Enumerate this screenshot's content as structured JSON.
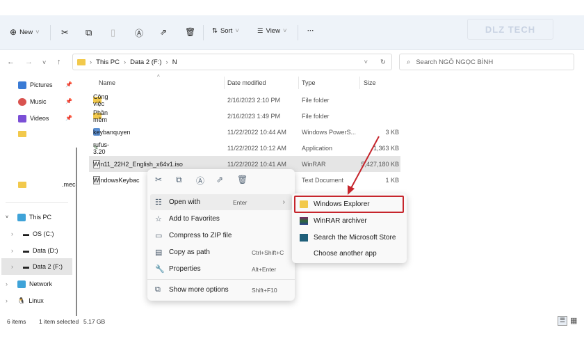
{
  "toolbar": {
    "new": "New",
    "sort": "Sort",
    "view": "View",
    "more": "···",
    "logo": "DLZ TECH"
  },
  "address": {
    "parts": [
      "This PC",
      "Data 2 (F:)",
      "N"
    ],
    "search_placeholder": "Search NGÔ NGỌC BÌNH"
  },
  "sidebar": {
    "quick": [
      {
        "label": "Pictures",
        "color": "#3a7bd5"
      },
      {
        "label": "Music",
        "color": "#d9534f"
      },
      {
        "label": "Videos",
        "color": "#7b4fd6"
      }
    ],
    "hidden_item": ".mec",
    "this_pc": "This PC",
    "drives": [
      "OS (C:)",
      "Data (D:)",
      "Data 2 (F:)"
    ],
    "network": "Network",
    "linux": "Linux"
  },
  "columns": [
    "Name",
    "Date modified",
    "Type",
    "Size"
  ],
  "files": [
    {
      "name": "Công việc",
      "date": "2/16/2023 2:10 PM",
      "type": "File folder",
      "size": "",
      "icon": "folder"
    },
    {
      "name": "Phần mềm",
      "date": "2/16/2023 1:49 PM",
      "type": "File folder",
      "size": "",
      "icon": "folder"
    },
    {
      "name": "keybanquyen",
      "date": "11/22/2022 10:44 AM",
      "type": "Windows PowerS...",
      "size": "3 KB",
      "icon": "powershell"
    },
    {
      "name": "rufus-3.20",
      "date": "11/22/2022 10:12 AM",
      "type": "Application",
      "size": "1,363 KB",
      "icon": "app"
    },
    {
      "name": "Win11_22H2_English_x64v1.iso",
      "date": "11/22/2022 10:41 AM",
      "type": "WinRAR",
      "size": "5,427,180 KB",
      "icon": "file"
    },
    {
      "name": "WindowsKeybac",
      "date": "",
      "type": "Text Document",
      "size": "1 KB",
      "icon": "text"
    }
  ],
  "context_menu": {
    "items": [
      {
        "label": "Open with",
        "shortcut": "Enter"
      },
      {
        "label": "Add to Favorites",
        "shortcut": ""
      },
      {
        "label": "Compress to ZIP file",
        "shortcut": ""
      },
      {
        "label": "Copy as path",
        "shortcut": "Ctrl+Shift+C"
      },
      {
        "label": "Properties",
        "shortcut": "Alt+Enter"
      },
      {
        "label": "Show more options",
        "shortcut": "Shift+F10"
      }
    ]
  },
  "submenu": {
    "items": [
      "Windows Explorer",
      "WinRAR archiver",
      "Search the Microsoft Store",
      "Choose another app"
    ]
  },
  "status": {
    "count": "6 items",
    "selected": "1 item selected",
    "size": "5.17 GB"
  },
  "colors": {
    "highlight": "#c6252c",
    "folder": "#f2c94c"
  }
}
